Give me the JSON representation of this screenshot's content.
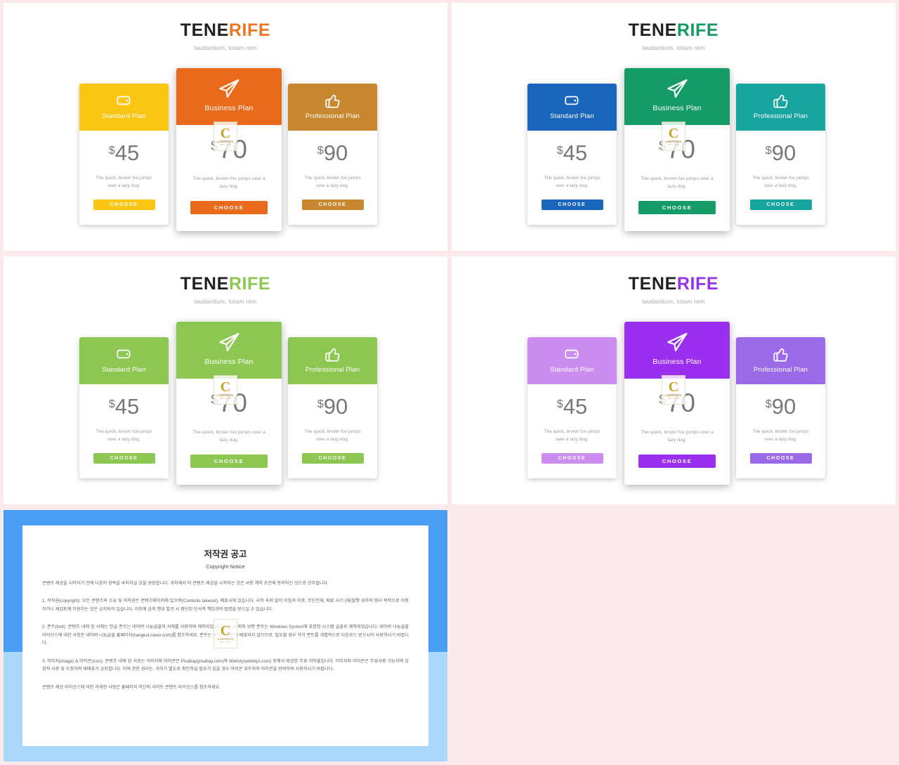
{
  "background_color": "#fbe9ec",
  "slides": [
    {
      "id": "slide-orange",
      "brand": {
        "part1": "TENE",
        "part2": "RIFE",
        "accent": "#ee7624",
        "subtitle": "laudantium, totam rem"
      },
      "cards": [
        {
          "name": "Standard Plan",
          "icon": "tag-icon",
          "currency": "$",
          "price": "45",
          "desc": "The quick, brown fox jumps over a lazy dog.",
          "button": "CHOOSE",
          "color": "#fbc513",
          "featured": false
        },
        {
          "name": "Business Plan",
          "icon": "paper-plane-icon",
          "currency": "$",
          "price": "70",
          "desc": "The quick, brown fox jumps over a lazy dog.",
          "button": "CHOOSE",
          "color": "#e96a1b",
          "featured": true
        },
        {
          "name": "Professional Plan",
          "icon": "thumbs-up-icon",
          "currency": "$",
          "price": "90",
          "desc": "The quick, brown fox jumps over a lazy dog.",
          "button": "CHOOSE",
          "color": "#c9882f",
          "featured": false
        }
      ]
    },
    {
      "id": "slide-green",
      "brand": {
        "part1": "TENE",
        "part2": "RIFE",
        "accent": "#149b62",
        "subtitle": "laudantium, totam rem"
      },
      "cards": [
        {
          "name": "Standard Plan",
          "icon": "tag-icon",
          "currency": "$",
          "price": "45",
          "desc": "The quick, brown fox jumps over a lazy dog.",
          "button": "CHOOSE",
          "color": "#1b66bd",
          "featured": false
        },
        {
          "name": "Business Plan",
          "icon": "paper-plane-icon",
          "currency": "$",
          "price": "70",
          "desc": "The quick, brown fox jumps over a lazy dog.",
          "button": "CHOOSE",
          "color": "#159b66",
          "featured": true
        },
        {
          "name": "Professional Plan",
          "icon": "thumbs-up-icon",
          "currency": "$",
          "price": "90",
          "desc": "The quick, brown fox jumps over a lazy dog.",
          "button": "CHOOSE",
          "color": "#18a5a0",
          "featured": false
        }
      ]
    },
    {
      "id": "slide-lime",
      "brand": {
        "part1": "TENE",
        "part2": "RIFE",
        "accent": "#8cc751",
        "subtitle": "laudantium, totam rem"
      },
      "cards": [
        {
          "name": "Standard Plan",
          "icon": "tag-icon",
          "currency": "$",
          "price": "45",
          "desc": "The quick, brown fox jumps over a lazy dog.",
          "button": "CHOOSE",
          "color": "#8cc751",
          "featured": false
        },
        {
          "name": "Business Plan",
          "icon": "paper-plane-icon",
          "currency": "$",
          "price": "70",
          "desc": "The quick, brown fox jumps over a lazy dog.",
          "button": "CHOOSE",
          "color": "#8cc751",
          "featured": true
        },
        {
          "name": "Professional Plan",
          "icon": "thumbs-up-icon",
          "currency": "$",
          "price": "90",
          "desc": "The quick, brown fox jumps over a lazy dog.",
          "button": "CHOOSE",
          "color": "#8cc751",
          "featured": false
        }
      ]
    },
    {
      "id": "slide-purple",
      "brand": {
        "part1": "TENE",
        "part2": "RIFE",
        "accent": "#9333ea",
        "subtitle": "laudantium, totam rem"
      },
      "cards": [
        {
          "name": "Standard Plan",
          "icon": "tag-icon",
          "currency": "$",
          "price": "45",
          "desc": "The quick, brown fox jumps over a lazy dog.",
          "button": "CHOOSE",
          "color": "#cb8df0",
          "featured": false
        },
        {
          "name": "Business Plan",
          "icon": "paper-plane-icon",
          "currency": "$",
          "price": "70",
          "desc": "The quick, brown fox jumps over a lazy dog.",
          "button": "CHOOSE",
          "color": "#9b2fef",
          "featured": true
        },
        {
          "name": "Professional Plan",
          "icon": "thumbs-up-icon",
          "currency": "$",
          "price": "90",
          "desc": "The quick, brown fox jumps over a lazy dog.",
          "button": "CHOOSE",
          "color": "#9a6ae8",
          "featured": false
        }
      ]
    }
  ],
  "watermark": {
    "letter": "C",
    "line1": "CONTENTS",
    "line2": "PPT / CLIP"
  },
  "copyright_slide": {
    "frame_color": "#4a9ff5",
    "selection_color": "#aad8fb",
    "title_ko": "저작권 공고",
    "title_en": "Copyright Notice",
    "intro": "콘텐츠 제공을 시작하기 전에 다음의 항목을 숙지하실 것을 권장합니다. 귀하께서 이 콘텐츠 제공을 시작하는 것은 사용 계약 조건에 동의하신 것으로 간주됩니다.",
    "section1": "1. 저작권(copyright): 모든 콘텐츠의 소유 및 저작권은 콘텐츠메이커에 있으며(Contents takeout), 배포시에 있습니다. 시작 숙지 없이 모집과 이용, 무단전재, 배포 시기 (재)발행 위하여 영리 목적으로 이용하거나 재검토에 이용하는 것은 금지되어 있습니다. 이후에 금칙 행위 발견 시 중단된 민사적 책임과의 법령을 받으실 수 있습니다.",
    "section2": "2. 폰트(font): 콘텐츠 내에 된 서체는 한글 폰트는 네이버 나눔글꼴의 서체를 사용하여 제작되었습니다. 한글 외의 보편 폰트는 Windows System에 포함된 시스템 글꼴로 제작되었습니다. 네이버 나눔글꼴 라이선스에 대한 사항은 네이버 나눔글꼴 홈페이지(hangeul.naver.com)를 참조하세요. 폰트는 콘텐츠의 함께 배포되지 않으므로, 필요할 경우 각각 폰트를 개별적으로 다운로드 받으시어 사용하시기 바랍니다.",
    "section3": "3. 이미지(image) & 아이콘(icon): 콘텐츠 내에 된 서로는 이미지와 아이콘은 Pixabay(pixabay.com)와 Weboly(webolys.com) 등에서 제공한 무료 저작물입니다. 이미지와 아이콘은 무료사용 가능하며 상업적 사용 및 수정하여 재배포가 금지합니다. 이에 관한 권리는, 귀하가 별도로 확인하실 필요가 있을 경우 아이콘 위주하여 아이콘을 반려하여 사용하시기 바랍니다.",
    "outro": "콘텐츠 제공 라이선스에 대한 자세한 사항은 홈페이지 하단의 사이트 콘텐츠 라이선스를 참조하세요."
  }
}
